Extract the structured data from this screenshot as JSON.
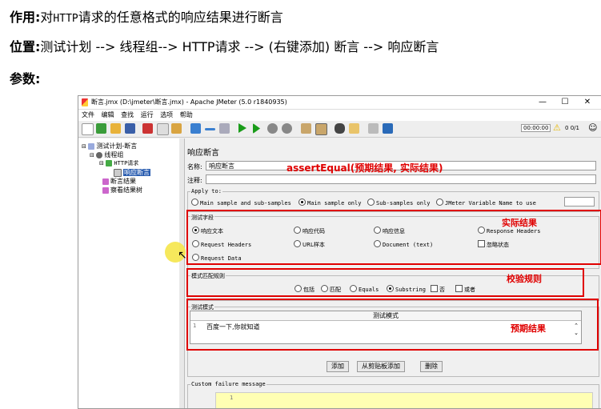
{
  "doc": {
    "line1_label": "作用:",
    "line1_text_a": "对",
    "line1_mono": "HTTP",
    "line1_text_b": "请求的任意格式的响应结果进行断言",
    "line2_label": "位置:",
    "line2_text": "测试计划 --> 线程组--> HTTP请求 --> (右键添加) 断言 --> 响应断言",
    "line3_label": "参数:"
  },
  "window": {
    "title": "断言.jmx (D:\\jmeter\\断言.jmx) - Apache JMeter (5.0 r1840935)",
    "controls": [
      "—",
      "☐",
      "✕"
    ],
    "menu": [
      "文件",
      "编辑",
      "查找",
      "运行",
      "选项",
      "帮助"
    ],
    "timer": "00:00:00",
    "warn_count": "0",
    "thread_count": "0/1"
  },
  "tree": {
    "items": [
      "测试计划-断言",
      "线程组",
      "HTTP请求",
      "响应断言",
      "断言结果",
      "察看结果树"
    ]
  },
  "panel": {
    "title": "响应断言",
    "name_label": "名称:",
    "name_value": "响应断言",
    "comment_label": "注释:",
    "apply_to_title": "Apply to:",
    "apply_to_options": [
      "Main sample and sub-samples",
      "Main sample only",
      "Sub-samples only",
      "JMeter Variable Name to use"
    ],
    "field_title": "测试字段",
    "field_options": [
      "响应文本",
      "响应代码",
      "响应信息",
      "Response Headers",
      "Request Headers",
      "URL样本",
      "Document (text)",
      "忽略状态",
      "Request Data"
    ],
    "rule_title": "模式匹配规则",
    "rule_options": [
      "包括",
      "匹配",
      "Equals",
      "Substring",
      "否",
      "或者"
    ],
    "pattern_title": "测试模式",
    "pattern_header": "测试模式",
    "pattern_line_no": "1",
    "pattern_value": "百度一下,你就知道",
    "buttons": [
      "添加",
      "从剪贴板添加",
      "删除"
    ],
    "custom_failure_label": "Custom failure message",
    "custom_line_no": "1"
  },
  "annotations": {
    "assert_text": "assertEqual(预期结果, 实际结果)",
    "actual": "实际结果",
    "rule": "校验规则",
    "expected": "预期结果",
    "color": "#e00000"
  }
}
